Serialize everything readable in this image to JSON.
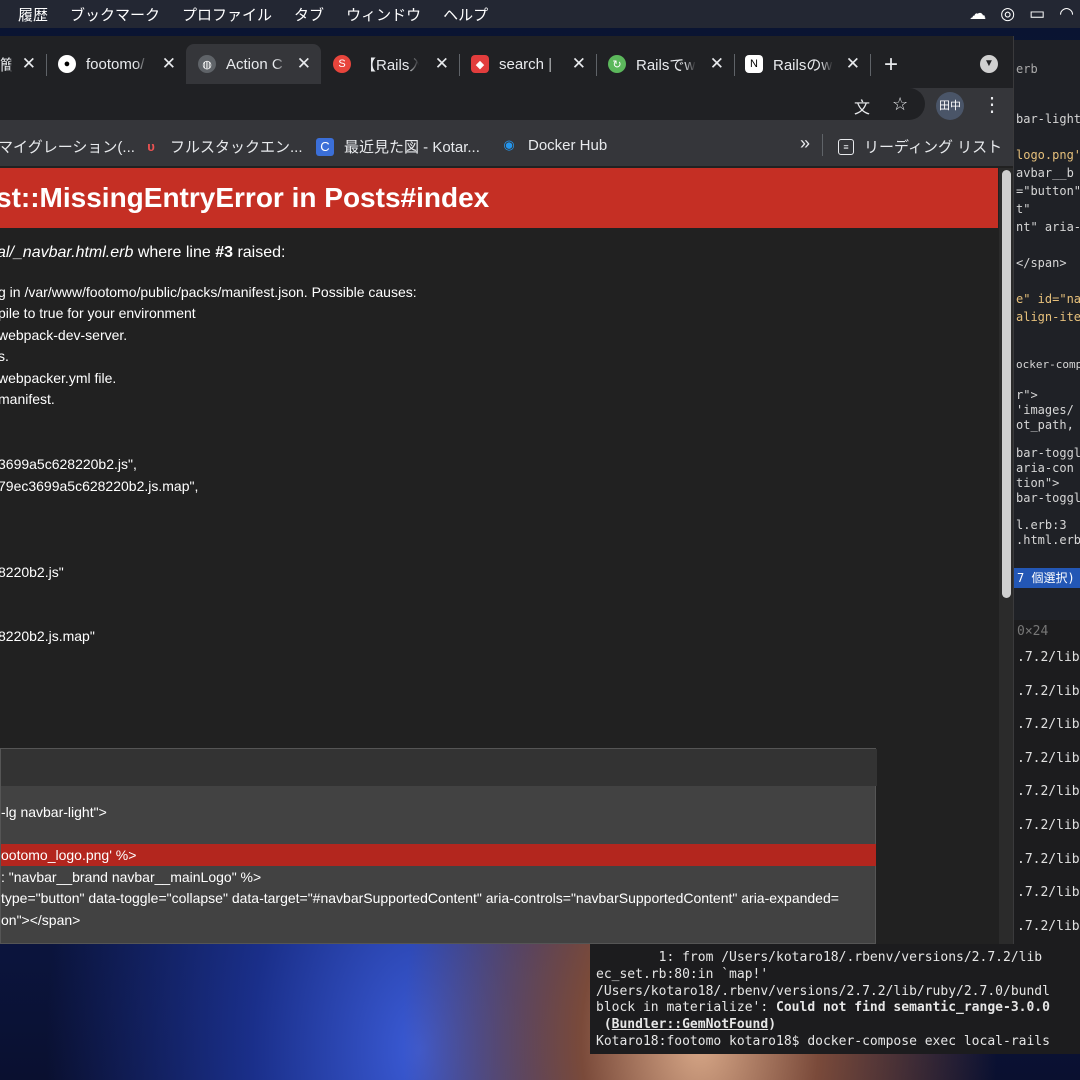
{
  "menubar": {
    "items": [
      "履歴",
      "ブックマーク",
      "プロファイル",
      "タブ",
      "ウィンドウ",
      "ヘルプ"
    ]
  },
  "tabs": [
    {
      "title": "簡",
      "icon": "github-icon"
    },
    {
      "title": "footomo/",
      "icon": "github-icon"
    },
    {
      "title": "Action C",
      "icon": "globe-icon"
    },
    {
      "title": "【Rails入",
      "icon": "swarm-icon"
    },
    {
      "title": "search |",
      "icon": "shield-icon"
    },
    {
      "title": "Railsでw",
      "icon": "refresh-icon"
    },
    {
      "title": "Railsのw",
      "icon": "notion-icon"
    }
  ],
  "toolbar": {
    "profile_label": "田中"
  },
  "bookmarks": [
    {
      "label": "マイグレーション(...",
      "icon": "folder-icon"
    },
    {
      "label": "フルスタックエン...",
      "icon": "udemy-icon"
    },
    {
      "label": "最近見た図 - Kotar...",
      "icon": "cacoo-icon"
    },
    {
      "label": "Docker Hub",
      "icon": "docker-icon"
    }
  ],
  "bookmarks_more": "»",
  "reading_list": "リーディング リスト",
  "error": {
    "title": "st::MissingEntryError in Posts#index",
    "source_prefix": "al/_navbar.html.erb",
    "source_mid": " where line ",
    "source_line": "#3",
    "source_suffix": " raised:",
    "message_lines": [
      "g in /var/www/footomo/public/packs/manifest.json. Possible causes:",
      "pile to true for your environment",
      "webpack-dev-server.",
      "s.",
      "webpacker.yml file.",
      "manifest.",
      "3699a5c628220b2.js\",",
      "79ec3699a5c628220b2.js.map\",",
      "8220b2.js\"",
      "8220b2.js.map\""
    ]
  },
  "code_lines": [
    "-lg navbar-light\">",
    "",
    "ootomo_logo.png' %>",
    ": \"navbar__brand navbar__mainLogo\" %>",
    "type=\"button\" data-toggle=\"collapse\" data-target=\"#navbarSupportedContent\" aria-controls=\"navbarSupportedContent\" aria-expanded=",
    "on\"></span>"
  ],
  "editor_lines": [
    "bar-light\"",
    "logo.png'",
    "avbar__b",
    "=\"button\"",
    "t\"",
    "nt\" aria-c",
    "</span>",
    "e\" id=\"nav",
    "align-ite",
    "ocker-compo",
    "r\">",
    " 'images/",
    "ot_path,",
    "bar-toggl",
    " aria-con",
    "tion\">",
    "bar-toggl",
    "l.erb:3",
    ".html.erb",
    "7 個選択)"
  ],
  "term_right_lines": [
    "0×24",
    ".7.2/lib",
    ".7.2/lib",
    ".7.2/lib",
    ".7.2/lib",
    ".7.2/lib",
    ".7.2/lib",
    ".7.2/lib",
    ".7.2/lib",
    ".7.2/lib"
  ],
  "terminal": {
    "line1": "        1: from /Users/kotaro18/.rbenv/versions/2.7.2/lib",
    "line2": "ec_set.rb:80:in `map!'",
    "line3": "/Users/kotaro18/.rbenv/versions/2.7.2/lib/ruby/2.7.0/bundl",
    "line4_a": "block in materialize': ",
    "line4_b": "Could not find semantic_range-3.0.0",
    "line5_a": " (",
    "line5_b": "Bundler::GemNotFound",
    "line5_c": ")",
    "prompt": "Kotaro18:footomo kotaro18$ docker-compose exec local-rails"
  }
}
